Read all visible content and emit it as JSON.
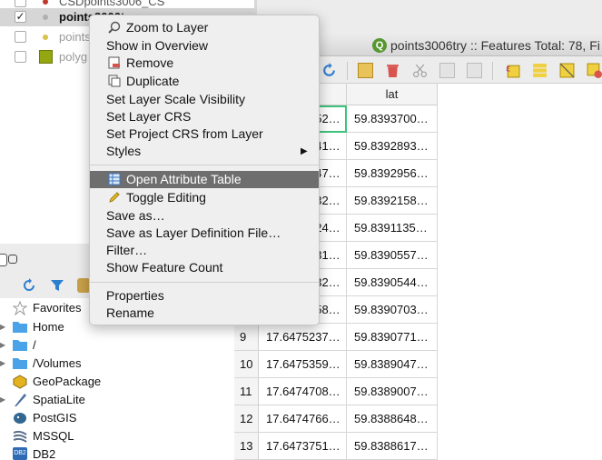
{
  "layers": [
    {
      "name": "CSDpoints3006_CS",
      "checked": false,
      "color": "#c0392b",
      "type": "point"
    },
    {
      "name": "points3006try",
      "checked": true,
      "color": "#b0b0b0",
      "type": "point"
    },
    {
      "name": "points",
      "checked": false,
      "color": "#d8c24a",
      "type": "point"
    },
    {
      "name": "polyg",
      "checked": false,
      "color": "#94a610",
      "type": "polygon"
    }
  ],
  "checkmark": "✓",
  "context_menu": {
    "items": [
      {
        "label": "Zoom to Layer",
        "icon": "zoom-icon"
      },
      {
        "label": "Show in Overview",
        "icon": ""
      },
      {
        "label": "Remove",
        "icon": "remove-icon"
      },
      {
        "label": "Duplicate",
        "icon": "duplicate-icon"
      },
      {
        "label": "Set Layer Scale Visibility",
        "icon": ""
      },
      {
        "label": "Set Layer CRS",
        "icon": ""
      },
      {
        "label": "Set Project CRS from Layer",
        "icon": ""
      },
      {
        "label": "Styles",
        "icon": "",
        "submenu": true
      },
      {
        "label": "Open Attribute Table",
        "icon": "table-icon",
        "highlighted": true
      },
      {
        "label": "Toggle Editing",
        "icon": "pencil-icon"
      },
      {
        "label": "Save as…",
        "icon": ""
      },
      {
        "label": "Save as Layer Definition File…",
        "icon": ""
      },
      {
        "label": "Filter…",
        "icon": ""
      },
      {
        "label": "Show Feature Count",
        "icon": ""
      },
      {
        "label": "Properties",
        "icon": ""
      },
      {
        "label": "Rename",
        "icon": ""
      }
    ],
    "submenu_arrow": "▶"
  },
  "browser": {
    "items": [
      {
        "label": "Favorites",
        "icon": "star-icon",
        "arrow": ""
      },
      {
        "label": "Home",
        "icon": "folder-icon",
        "arrow": "▶"
      },
      {
        "label": "/",
        "icon": "folder-icon",
        "arrow": "▶"
      },
      {
        "label": "/Volumes",
        "icon": "folder-icon",
        "arrow": "▶"
      },
      {
        "label": "GeoPackage",
        "icon": "geopackage-icon",
        "arrow": ""
      },
      {
        "label": "SpatiaLite",
        "icon": "spatialite-icon",
        "arrow": "▶"
      },
      {
        "label": "PostGIS",
        "icon": "postgis-icon",
        "arrow": ""
      },
      {
        "label": "MSSQL",
        "icon": "mssql-icon",
        "arrow": ""
      },
      {
        "label": "DB2",
        "icon": "db2-icon",
        "arrow": ""
      }
    ],
    "db2_badge": "DB2"
  },
  "attribute_table": {
    "window_title": "points3006try :: Features Total: 78, Fi",
    "logo_letter": "Q",
    "columns": [
      "lon",
      "lat"
    ],
    "rows": [
      {
        "num": "1",
        "lon": "17.6474752…",
        "lat": "59.8393700…"
      },
      {
        "num": "2",
        "lon": "17.6474841…",
        "lat": "59.8392893…"
      },
      {
        "num": "3",
        "lon": "17.6474847…",
        "lat": "59.8392956…"
      },
      {
        "num": "4",
        "lon": "17.6474832…",
        "lat": "59.8392158…"
      },
      {
        "num": "5",
        "lon": "17.6474824…",
        "lat": "59.8391135…"
      },
      {
        "num": "6",
        "lon": "17.6474831…",
        "lat": "59.8390557…"
      },
      {
        "num": "7",
        "lon": "17.6474832…",
        "lat": "59.8390544…"
      },
      {
        "num": "8",
        "lon": "17.6474858…",
        "lat": "59.8390703…"
      },
      {
        "num": "9",
        "lon": "17.6475237…",
        "lat": "59.8390771…"
      },
      {
        "num": "10",
        "lon": "17.6475359…",
        "lat": "59.8389047…"
      },
      {
        "num": "11",
        "lon": "17.6474708…",
        "lat": "59.8389007…"
      },
      {
        "num": "12",
        "lon": "17.6474766…",
        "lat": "59.8388648…"
      },
      {
        "num": "13",
        "lon": "17.6473751…",
        "lat": "59.8388617…"
      }
    ]
  },
  "colors": {
    "highlight": "#6e6e6e",
    "selected_cell_border": "#3ec27a",
    "qgis_green": "#589632",
    "folder_blue": "#4aa3e8",
    "polygon_green": "#94a610"
  }
}
